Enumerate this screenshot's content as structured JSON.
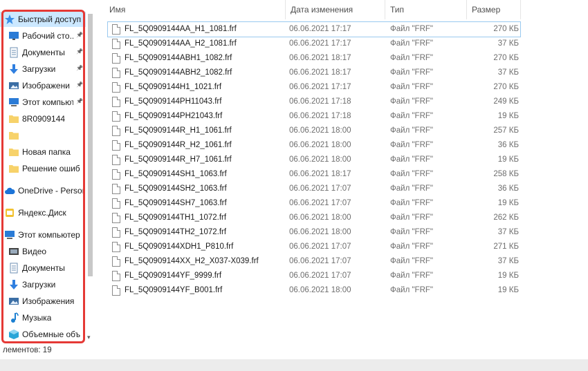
{
  "nav": {
    "items": [
      {
        "label": "Быстрый доступ",
        "icon": "star-icon",
        "selected": true,
        "pinned": false,
        "color": "#3a8ee6"
      },
      {
        "label": "Рабочий сто...",
        "icon": "desktop-icon",
        "selected": false,
        "pinned": true,
        "color": "#2b7bd6"
      },
      {
        "label": "Документы",
        "icon": "documents-icon",
        "selected": false,
        "pinned": true,
        "color": "#6d8fb3"
      },
      {
        "label": "Загрузки",
        "icon": "download-arrow-icon",
        "selected": false,
        "pinned": true,
        "color": "#2f7fe0"
      },
      {
        "label": "Изображени",
        "icon": "pictures-icon",
        "selected": false,
        "pinned": true,
        "color": "#3b6ea5"
      },
      {
        "label": "Этот компьют",
        "icon": "computer-icon",
        "selected": false,
        "pinned": true,
        "color": "#2b7bd6"
      },
      {
        "label": "8R0909144",
        "icon": "folder-icon",
        "selected": false,
        "pinned": false,
        "color": "#f7d26a"
      },
      {
        "label": "",
        "icon": "folder-icon",
        "selected": false,
        "pinned": false,
        "color": "#f7d26a"
      },
      {
        "label": "Новая папка",
        "icon": "folder-icon",
        "selected": false,
        "pinned": false,
        "color": "#f7d26a"
      },
      {
        "label": "Решение ошиб",
        "icon": "folder-icon",
        "selected": false,
        "pinned": false,
        "color": "#f7d26a"
      },
      {
        "label": "OneDrive - Persor",
        "icon": "cloud-icon",
        "selected": false,
        "pinned": false,
        "color": "#1c74d8"
      },
      {
        "label": "Яндекс.Диск",
        "icon": "yandex-disk-icon",
        "selected": false,
        "pinned": false,
        "color": "#f2c232"
      },
      {
        "label": "Этот компьютер",
        "icon": "computer-icon",
        "selected": false,
        "pinned": false,
        "color": "#2b7bd6"
      },
      {
        "label": "Видео",
        "icon": "video-icon",
        "selected": false,
        "pinned": false,
        "color": "#444"
      },
      {
        "label": "Документы",
        "icon": "documents-icon",
        "selected": false,
        "pinned": false,
        "color": "#6d8fb3"
      },
      {
        "label": "Загрузки",
        "icon": "download-arrow-icon",
        "selected": false,
        "pinned": false,
        "color": "#2f7fe0"
      },
      {
        "label": "Изображения",
        "icon": "pictures-icon",
        "selected": false,
        "pinned": false,
        "color": "#3b6ea5"
      },
      {
        "label": "Музыка",
        "icon": "music-note-icon",
        "selected": false,
        "pinned": false,
        "color": "#1b7fd1"
      },
      {
        "label": "Объемные объ",
        "icon": "3d-objects-icon",
        "selected": false,
        "pinned": false,
        "color": "#2aa6d8"
      }
    ]
  },
  "columns": {
    "name": "Имя",
    "date": "Дата изменения",
    "type": "Тип",
    "size": "Размер"
  },
  "files": [
    {
      "name": "FL_5Q0909144AA_H1_1081.frf",
      "date": "06.06.2021 17:17",
      "type": "Файл \"FRF\"",
      "size": "270 КБ"
    },
    {
      "name": "FL_5Q0909144AA_H2_1081.frf",
      "date": "06.06.2021 17:17",
      "type": "Файл \"FRF\"",
      "size": "37 КБ"
    },
    {
      "name": "FL_5Q0909144ABH1_1082.frf",
      "date": "06.06.2021 18:17",
      "type": "Файл \"FRF\"",
      "size": "270 КБ"
    },
    {
      "name": "FL_5Q0909144ABH2_1082.frf",
      "date": "06.06.2021 18:17",
      "type": "Файл \"FRF\"",
      "size": "37 КБ"
    },
    {
      "name": "FL_5Q0909144H1_1021.frf",
      "date": "06.06.2021 17:17",
      "type": "Файл \"FRF\"",
      "size": "270 КБ"
    },
    {
      "name": "FL_5Q0909144PH11043.frf",
      "date": "06.06.2021 17:18",
      "type": "Файл \"FRF\"",
      "size": "249 КБ"
    },
    {
      "name": "FL_5Q0909144PH21043.frf",
      "date": "06.06.2021 17:18",
      "type": "Файл \"FRF\"",
      "size": "19 КБ"
    },
    {
      "name": "FL_5Q0909144R_H1_1061.frf",
      "date": "06.06.2021 18:00",
      "type": "Файл \"FRF\"",
      "size": "257 КБ"
    },
    {
      "name": "FL_5Q0909144R_H2_1061.frf",
      "date": "06.06.2021 18:00",
      "type": "Файл \"FRF\"",
      "size": "36 КБ"
    },
    {
      "name": "FL_5Q0909144R_H7_1061.frf",
      "date": "06.06.2021 18:00",
      "type": "Файл \"FRF\"",
      "size": "19 КБ"
    },
    {
      "name": "FL_5Q0909144SH1_1063.frf",
      "date": "06.06.2021 18:17",
      "type": "Файл \"FRF\"",
      "size": "258 КБ"
    },
    {
      "name": "FL_5Q0909144SH2_1063.frf",
      "date": "06.06.2021 17:07",
      "type": "Файл \"FRF\"",
      "size": "36 КБ"
    },
    {
      "name": "FL_5Q0909144SH7_1063.frf",
      "date": "06.06.2021 17:07",
      "type": "Файл \"FRF\"",
      "size": "19 КБ"
    },
    {
      "name": "FL_5Q0909144TH1_1072.frf",
      "date": "06.06.2021 18:00",
      "type": "Файл \"FRF\"",
      "size": "262 КБ"
    },
    {
      "name": "FL_5Q0909144TH2_1072.frf",
      "date": "06.06.2021 18:00",
      "type": "Файл \"FRF\"",
      "size": "37 КБ"
    },
    {
      "name": "FL_5Q0909144XDH1_P810.frf",
      "date": "06.06.2021 17:07",
      "type": "Файл \"FRF\"",
      "size": "271 КБ"
    },
    {
      "name": "FL_5Q0909144XX_H2_X037-X039.frf",
      "date": "06.06.2021 17:07",
      "type": "Файл \"FRF\"",
      "size": "37 КБ"
    },
    {
      "name": "FL_5Q0909144YF_9999.frf",
      "date": "06.06.2021 17:07",
      "type": "Файл \"FRF\"",
      "size": "19 КБ"
    },
    {
      "name": "FL_5Q0909144YF_B001.frf",
      "date": "06.06.2021 18:00",
      "type": "Файл \"FRF\"",
      "size": "19 КБ"
    }
  ],
  "status": {
    "count_text": "лементов: 19"
  },
  "colors": {
    "highlight_frame": "#e53935",
    "selection": "#cce8ff"
  }
}
